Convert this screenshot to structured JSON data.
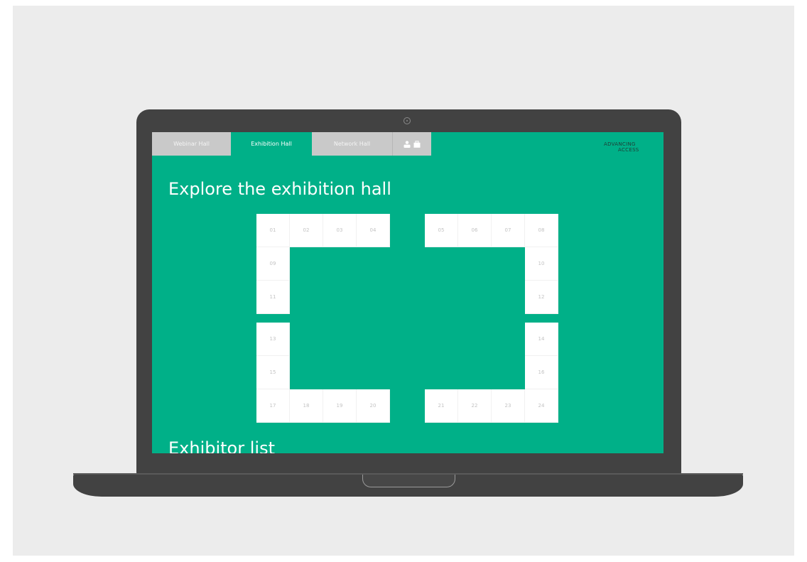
{
  "tabs": [
    {
      "label": "Webinar Hall",
      "active": false
    },
    {
      "label": "Exhibition Hall",
      "active": true
    },
    {
      "label": "Network Hall",
      "active": false
    }
  ],
  "tab_icons": [
    "user-icon",
    "briefcase-icon"
  ],
  "logo": {
    "line1": "ADVANCING",
    "line2": "ACCESS"
  },
  "page_title": "Explore the exhibition hall",
  "section_title": "Exhibitor list",
  "booths": [
    "01",
    "02",
    "03",
    "04",
    "05",
    "06",
    "07",
    "08",
    "09",
    "10",
    "11",
    "12",
    "13",
    "14",
    "15",
    "16",
    "17",
    "18",
    "19",
    "20",
    "21",
    "22",
    "23",
    "24"
  ],
  "colors": {
    "accent": "#00b088",
    "frame": "#424242",
    "background": "#ececec"
  }
}
